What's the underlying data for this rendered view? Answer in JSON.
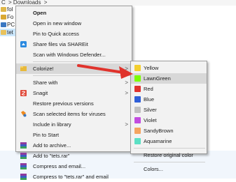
{
  "breadcrumb": {
    "left": "C",
    "sep1": ">",
    "folder": "Downloads",
    "sep2": ">"
  },
  "files": [
    {
      "label": "fol"
    },
    {
      "label": "Fo"
    },
    {
      "label": "PC"
    },
    {
      "label": "tet"
    }
  ],
  "context_menu": {
    "open": "Open",
    "open_new_window": "Open in new window",
    "pin_quick_access": "Pin to Quick access",
    "share_shareit": "Share files via SHAREit",
    "scan_defender": "Scan with Windows Defender...",
    "colorize": "Colorize!",
    "share_with": "Share with",
    "snagit": "Snagit",
    "restore_prev": "Restore previous versions",
    "scan_viruses": "Scan selected items for viruses",
    "include_library": "Include in library",
    "pin_start": "Pin to Start",
    "add_archive": "Add to archive...",
    "add_tets": "Add to \"tets.rar\"",
    "compress_email": "Compress and email...",
    "compress_tets_email": "Compress to \"tets.rar\" and email"
  },
  "colorize_submenu": {
    "items": [
      {
        "label": "Yellow",
        "color": "#f3cf2f"
      },
      {
        "label": "LawnGreen",
        "color": "#7cfc00"
      },
      {
        "label": "Red",
        "color": "#e0322e"
      },
      {
        "label": "Blue",
        "color": "#2f5fd8"
      },
      {
        "label": "Silver",
        "color": "#c0c0c0"
      },
      {
        "label": "Violet",
        "color": "#c24ce0"
      },
      {
        "label": "SandyBrown",
        "color": "#f4a460"
      },
      {
        "label": "Aquamarine",
        "color": "#5ce0c4"
      }
    ],
    "restore_original": "Restore original color",
    "colors": "Colors..."
  },
  "accent_colors": {
    "arrow": "#e0332c",
    "hover": "#d8d8d8"
  }
}
